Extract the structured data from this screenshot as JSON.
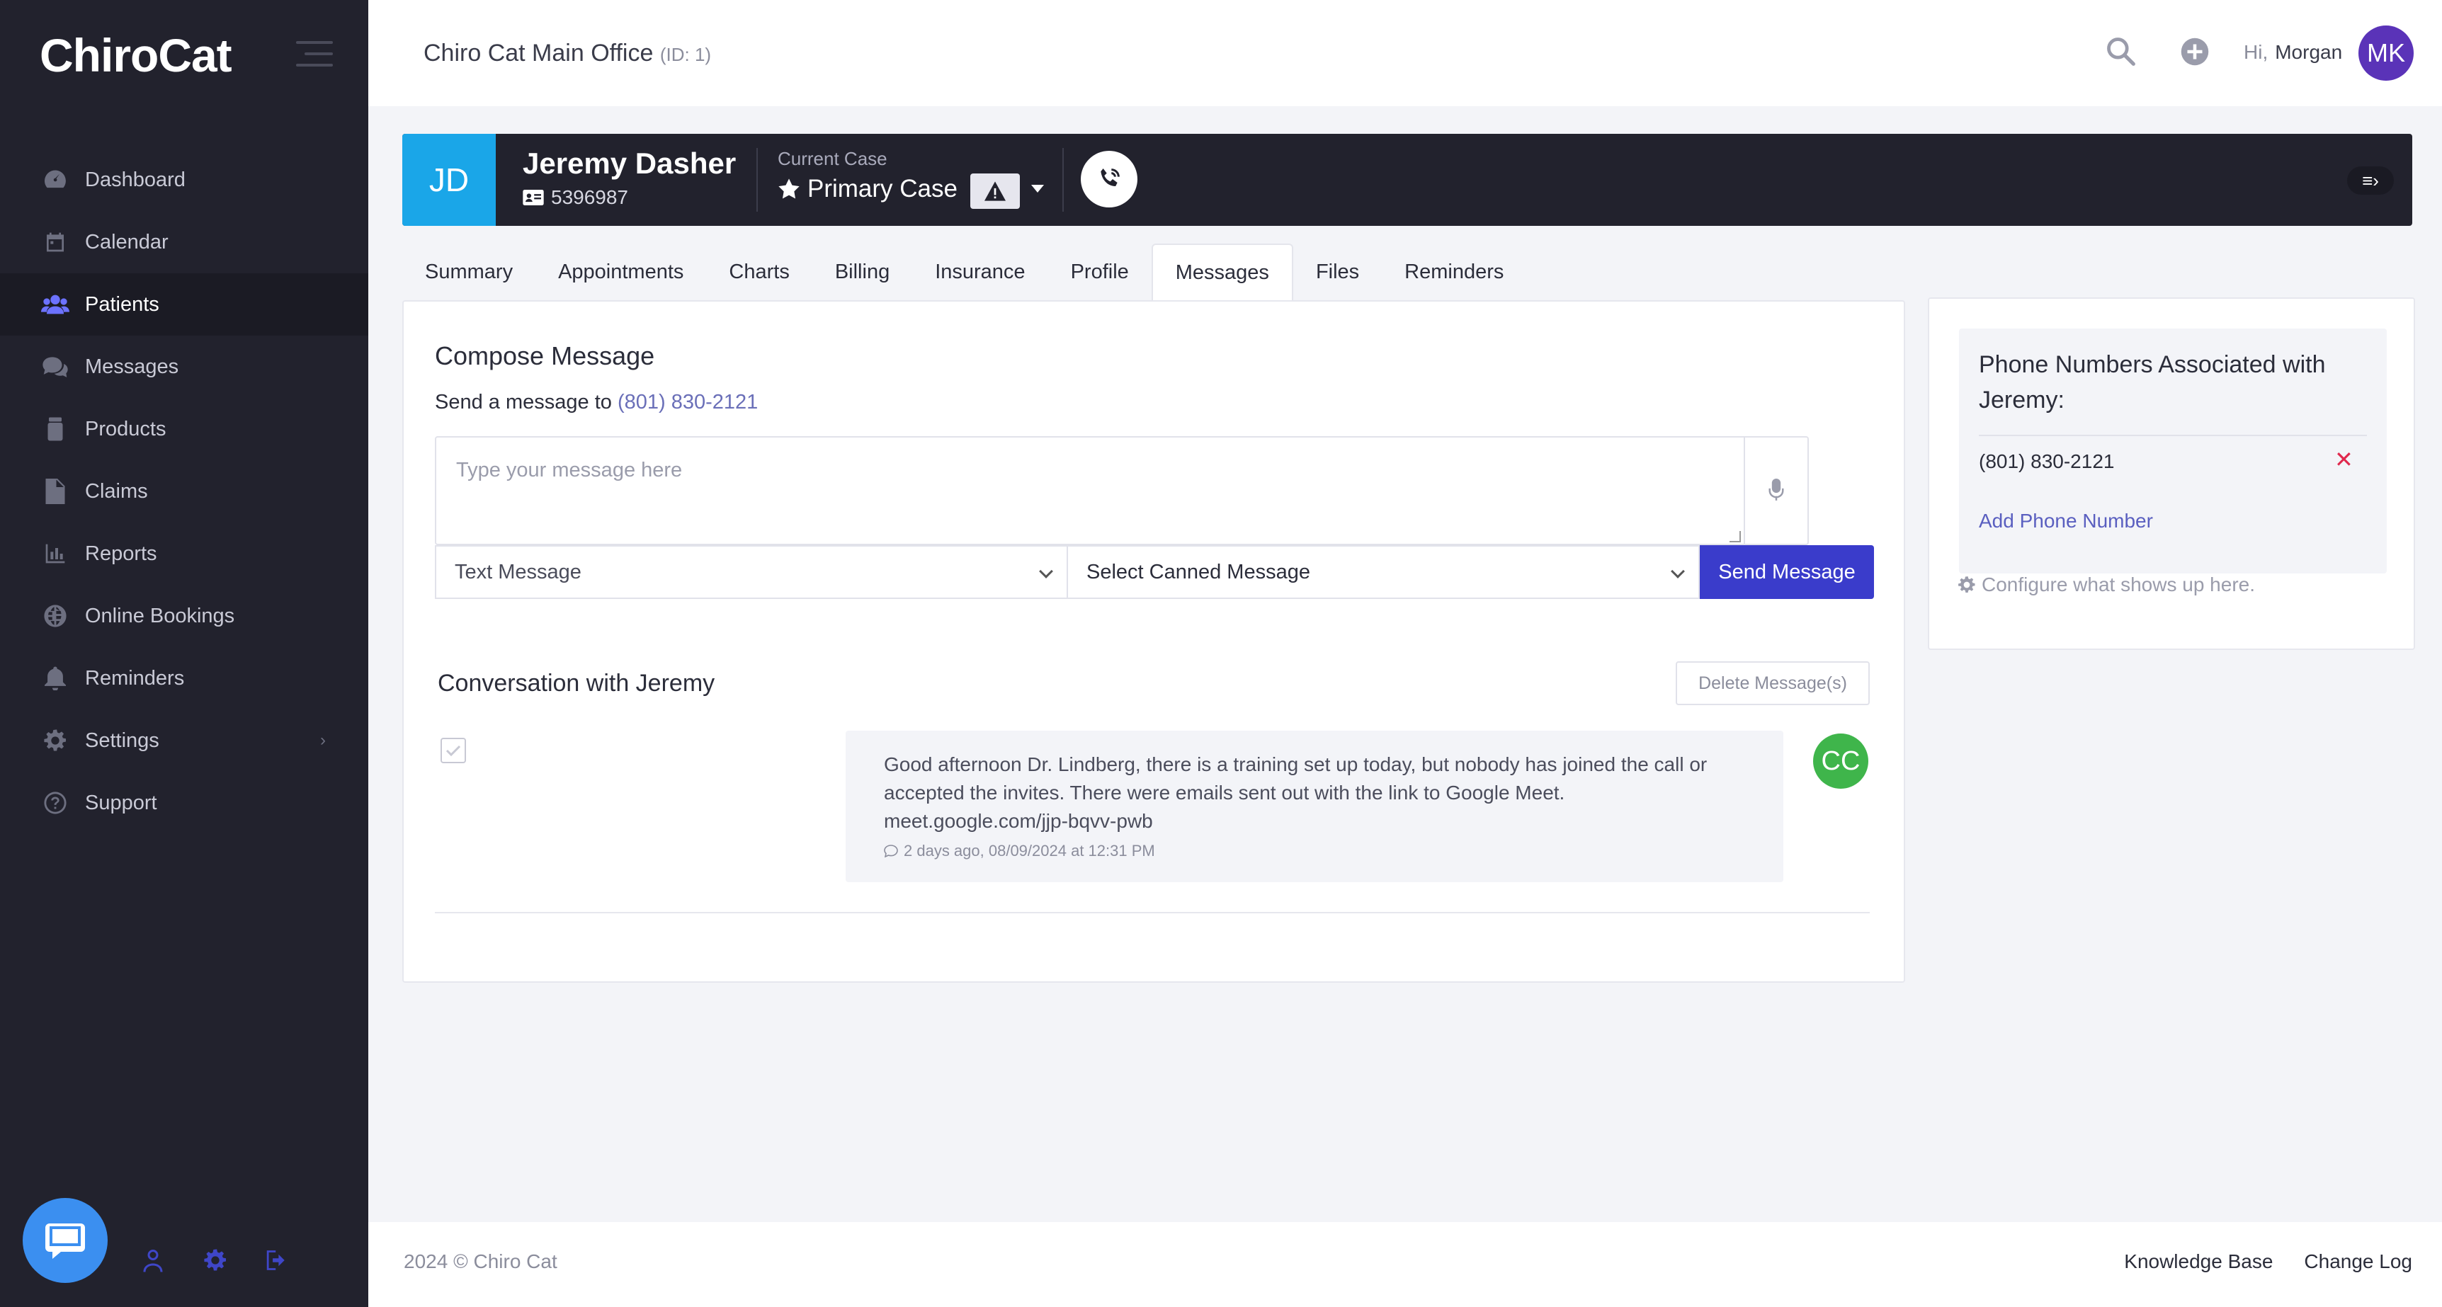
{
  "app": {
    "logo": "ChiroCat"
  },
  "sidebar": {
    "items": [
      {
        "label": "Dashboard",
        "icon": "dashboard-icon"
      },
      {
        "label": "Calendar",
        "icon": "calendar-icon"
      },
      {
        "label": "Patients",
        "icon": "users-icon",
        "active": true
      },
      {
        "label": "Messages",
        "icon": "chat-icon"
      },
      {
        "label": "Products",
        "icon": "products-icon"
      },
      {
        "label": "Claims",
        "icon": "file-icon"
      },
      {
        "label": "Reports",
        "icon": "bar-chart-icon"
      },
      {
        "label": "Online Bookings",
        "icon": "globe-icon"
      },
      {
        "label": "Reminders",
        "icon": "bell-icon"
      },
      {
        "label": "Settings",
        "icon": "gear-icon",
        "has_submenu": true
      },
      {
        "label": "Support",
        "icon": "question-icon"
      }
    ]
  },
  "topbar": {
    "office_name": "Chiro Cat Main Office",
    "office_id": "(ID: 1)",
    "greeting": "Hi,",
    "user_name": "Morgan",
    "avatar_initials": "MK"
  },
  "patient": {
    "initials": "JD",
    "name": "Jeremy Dasher",
    "id": "5396987",
    "current_case_label": "Current Case",
    "current_case": "Primary Case"
  },
  "tabs": [
    {
      "label": "Summary"
    },
    {
      "label": "Appointments"
    },
    {
      "label": "Charts"
    },
    {
      "label": "Billing"
    },
    {
      "label": "Insurance"
    },
    {
      "label": "Profile"
    },
    {
      "label": "Messages",
      "active": true
    },
    {
      "label": "Files"
    },
    {
      "label": "Reminders"
    }
  ],
  "compose": {
    "title": "Compose Message",
    "send_to_prefix": "Send a message to",
    "send_to_number": "(801) 830-2121",
    "placeholder": "Type your message here",
    "type_select": "Text Message",
    "canned_select": "Select Canned Message",
    "send_label": "Send Message"
  },
  "conversation": {
    "title": "Conversation with Jeremy",
    "delete_label": "Delete Message(s)",
    "messages": [
      {
        "text_line1": "Good afternoon Dr. Lindberg, there is a training set up today, but nobody has joined the call or",
        "text_line2": "accepted the invites. There were emails sent out with the link to Google Meet.",
        "text_line3": "meet.google.com/jjp-bqvv-pwb",
        "meta": "2 days ago, 08/09/2024 at 12:31 PM",
        "sender_initials": "CC"
      }
    ]
  },
  "phones_panel": {
    "title": "Phone Numbers Associated with Jeremy:",
    "numbers": [
      "(801) 830-2121"
    ],
    "add_label": "Add Phone Number",
    "configure_label": "Configure what shows up here."
  },
  "footer": {
    "copyright": "2024 © Chiro Cat",
    "links": [
      "Knowledge Base",
      "Change Log"
    ]
  },
  "colors": {
    "sidebar_bg": "#22222d",
    "accent": "#3a3ccb",
    "patient_badge": "#1aa6e8",
    "avatar": "#5a33b8",
    "sender_avatar": "#3fb54b",
    "danger": "#e0284d"
  }
}
